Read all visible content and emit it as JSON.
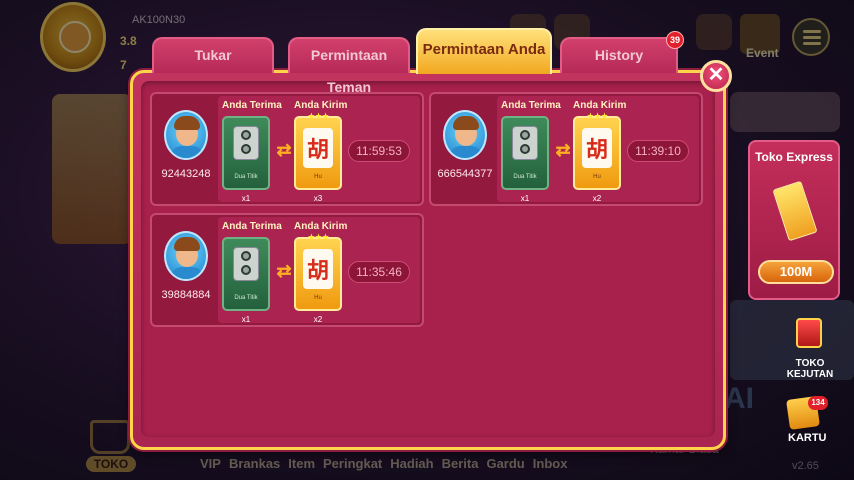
{
  "background": {
    "user_id": "AK100N30",
    "coins_1": "3.8",
    "coins_2": "7",
    "event_label": "Event",
    "ai_text": "AI",
    "room_label": "Kamar Biasa",
    "version": "v2.65",
    "toko_label": "TOKO",
    "bottom_nav": [
      "VIP",
      "Brankas",
      "Item",
      "Peringkat",
      "Hadiah",
      "Berita",
      "Gardu",
      "Inbox"
    ]
  },
  "tabs": {
    "tukar": "Tukar",
    "teman": "Permintaan Teman",
    "anda": "Permintaan Anda",
    "history": "History",
    "history_badge": "39"
  },
  "close_icon": "close-icon",
  "labels": {
    "terima": "Anda Terima",
    "kirim": "Anda Kirim"
  },
  "requests": [
    {
      "user_id": "92443248",
      "receive_name": "Dua Titik",
      "receive_qty": "x1",
      "send_glyph": "胡",
      "send_name": "Hu",
      "send_qty": "x3",
      "timer": "11:59:53"
    },
    {
      "user_id": "666544377",
      "receive_name": "Dua Titik",
      "receive_qty": "x1",
      "send_glyph": "胡",
      "send_name": "Hu",
      "send_qty": "x2",
      "timer": "11:39:10"
    },
    {
      "user_id": "39884884",
      "receive_name": "Dua Titik",
      "receive_qty": "x1",
      "send_glyph": "胡",
      "send_name": "Hu",
      "send_qty": "x2",
      "timer": "11:35:46"
    }
  ],
  "toko_express": {
    "title": "Toko Express",
    "price": "100M"
  },
  "toko_kejutan": {
    "label_1": "TOKO",
    "label_2": "KEJUTAN"
  },
  "kartu": {
    "label": "KARTU",
    "badge": "134"
  },
  "colors": {
    "dialog_bg": "#a8214c",
    "tab_active": "#f2a820",
    "accent_gold": "#ffd44a"
  }
}
